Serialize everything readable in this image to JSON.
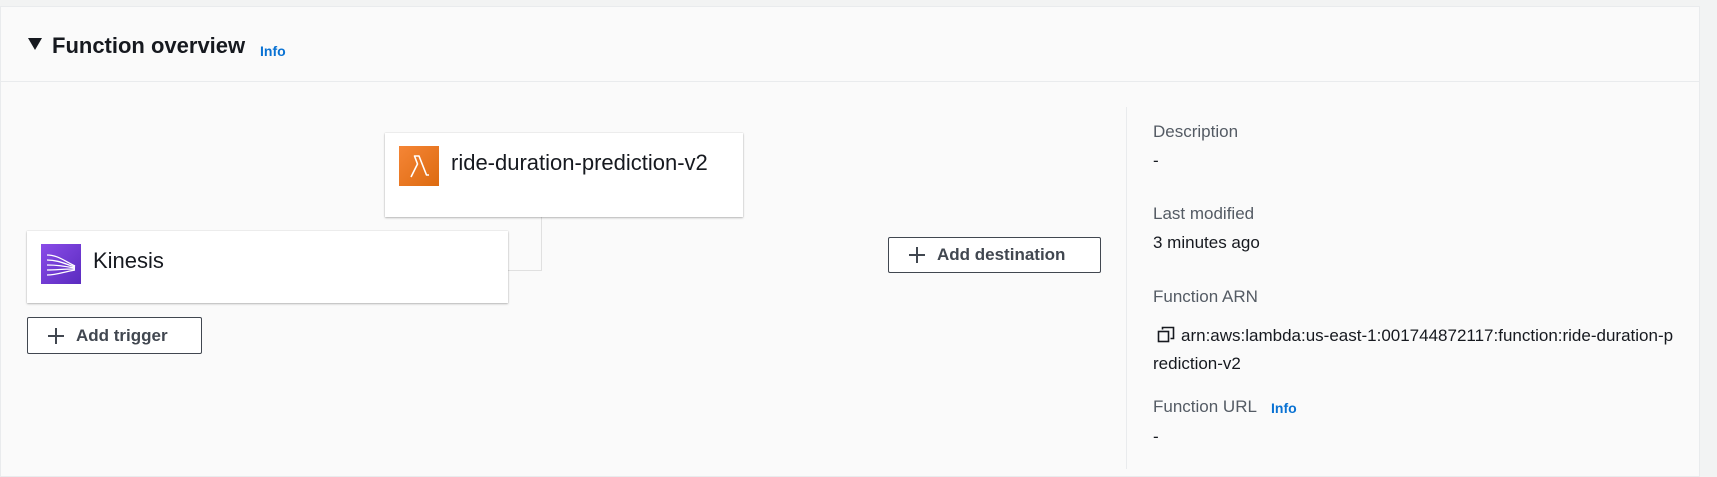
{
  "header": {
    "title": "Function overview",
    "info_label": "Info"
  },
  "diagram": {
    "function_name": "ride-duration-prediction-v2",
    "function_icon": "lambda-icon",
    "trigger_name": "Kinesis",
    "trigger_icon": "kinesis-icon",
    "add_destination_label": "Add destination",
    "add_trigger_label": "Add trigger"
  },
  "details": {
    "description_label": "Description",
    "description_value": "-",
    "last_modified_label": "Last modified",
    "last_modified_value": "3 minutes ago",
    "arn_label": "Function ARN",
    "arn_value": "arn:aws:lambda:us-east-1:001744872117:function:ride-duration-prediction-v2",
    "url_label": "Function URL",
    "url_info_label": "Info",
    "url_value": "-"
  },
  "colors": {
    "link": "#0972d3",
    "lambda": "#e8731a",
    "kinesis": "#7440d9"
  }
}
